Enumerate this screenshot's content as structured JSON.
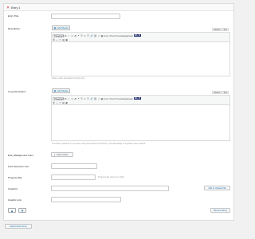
{
  "entry": {
    "title": "Entry 1",
    "close_symbol": "✕"
  },
  "fields": {
    "entry_title": "Entry Title",
    "description": "Description",
    "long_description": "Long Description",
    "bg_color": "Entry Background Color",
    "awesome_icon": "Font Awesome Icon",
    "progress_bar": "Progress Bar",
    "graphics": "Graphics",
    "graphic_link": "Graphic Link"
  },
  "editor": {
    "add_media": "Add Media",
    "tab_visual": "Visual",
    "tab_text": "Text",
    "format_select": "Paragraph",
    "extra_labels": [
      "Icon",
      "Chart",
      "Knowledgebase"
    ],
    "brand_badge": "B L O"
  },
  "hints": {
    "description": "Write a short description for this entry",
    "long_description": "This field is optional. If you write a long description for this Entry, this will display in a lightbox when clicked",
    "progress": "Progress bar value (0 to 100)"
  },
  "buttons": {
    "select_color": "Select Color",
    "add_upload_file": "Add or Upload File",
    "remove_entry": "Remove Entry",
    "add_another_entry": "Add Another Entry",
    "move_up": "▲",
    "move_down": "▼"
  },
  "colors": {
    "accent": "#2271b1",
    "brand": "#1d2a6b",
    "close": "#d63638"
  },
  "icons": [
    "close-icon",
    "media-icon",
    "bold-icon",
    "italic-icon",
    "list-icon",
    "quote-icon",
    "align-icon",
    "link-icon",
    "fullscreen-icon",
    "table-icon"
  ]
}
